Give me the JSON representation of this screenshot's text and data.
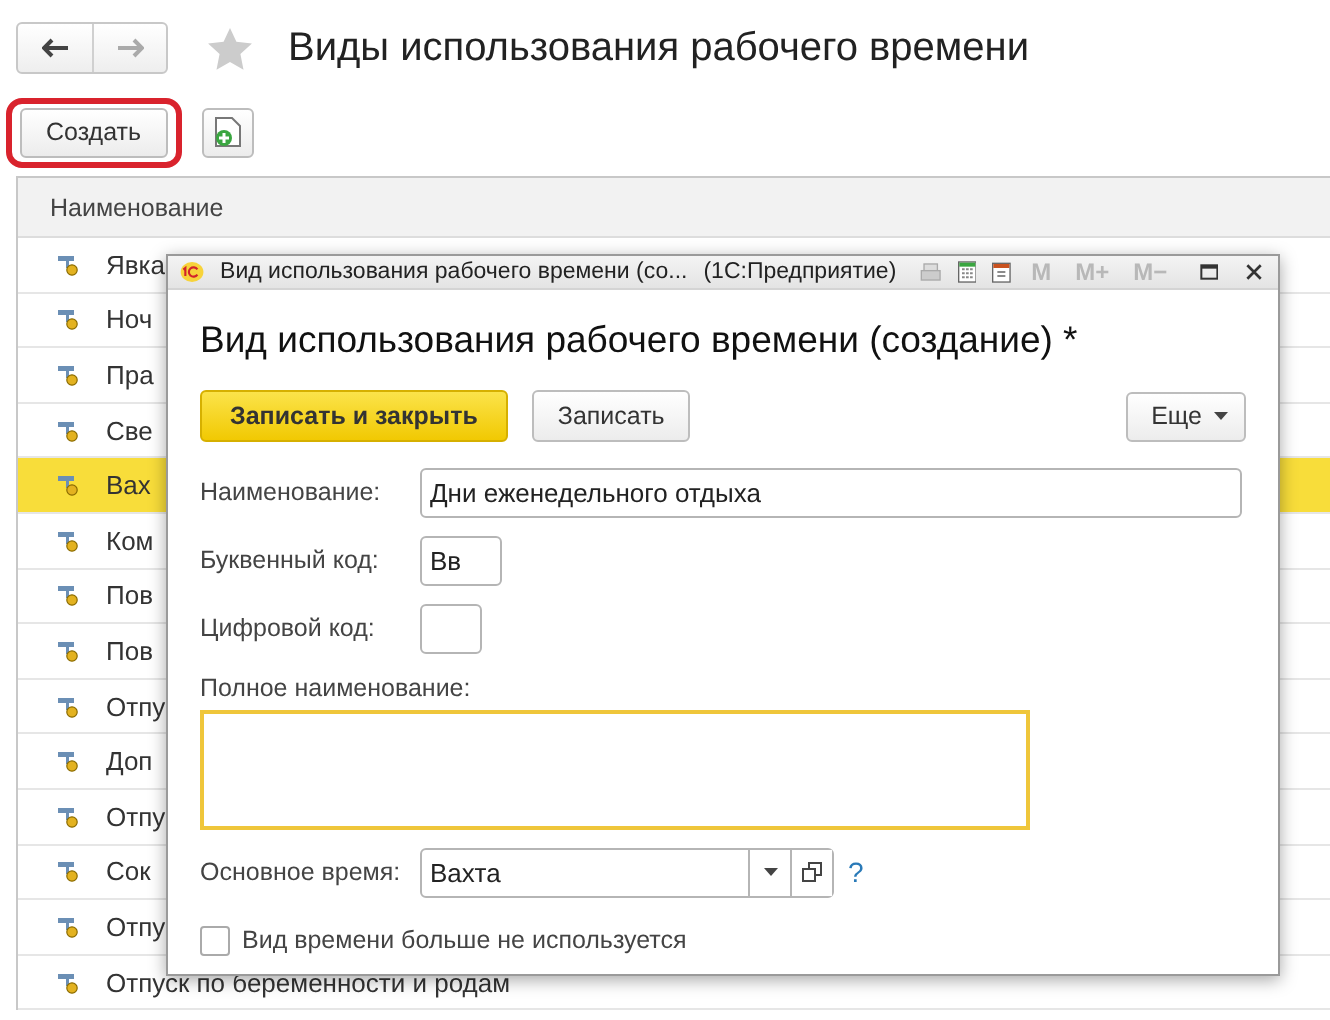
{
  "header": {
    "title": "Виды использования рабочего времени",
    "favorite": false
  },
  "toolbar": {
    "create_label": "Создать",
    "create_highlighted": true
  },
  "table": {
    "columns": [
      "Наименование"
    ],
    "rows": [
      {
        "name": "Явка",
        "selected": false
      },
      {
        "name": "Ноч",
        "selected": false
      },
      {
        "name": "Пра",
        "selected": false
      },
      {
        "name": "Све",
        "selected": false
      },
      {
        "name": "Вах",
        "selected": true
      },
      {
        "name": "Ком",
        "selected": false
      },
      {
        "name": "Пов",
        "selected": false
      },
      {
        "name": "Пов",
        "selected": false
      },
      {
        "name": "Отпу",
        "selected": false
      },
      {
        "name": "Доп",
        "selected": false
      },
      {
        "name": "Отпу",
        "selected": false
      },
      {
        "name": "Сок",
        "selected": false
      },
      {
        "name": "Отпу",
        "selected": false
      },
      {
        "name": "Отпуск по беременности и родам",
        "selected": false
      }
    ]
  },
  "dialog": {
    "title": "Вид использования рабочего времени (со...",
    "app": "(1С:Предприятие)",
    "memory_buttons": [
      "M",
      "M+",
      "M−"
    ],
    "heading": "Вид использования рабочего времени (создание) *",
    "save_close": "Записать и закрыть",
    "save": "Записать",
    "more": "Еще",
    "name": {
      "label": "Наименование:",
      "value": "Дни еженедельного отдыха"
    },
    "letter_code": {
      "label": "Буквенный код:",
      "value": "Вв"
    },
    "digit_code": {
      "label": "Цифровой код:"
    },
    "full_name": {
      "label": "Полное наименование:",
      "focused": true
    },
    "main_time": {
      "label": "Основное время:",
      "value": "Вахта",
      "help": "?"
    },
    "unused": {
      "label": "Вид времени больше не используется",
      "checked": false
    }
  }
}
